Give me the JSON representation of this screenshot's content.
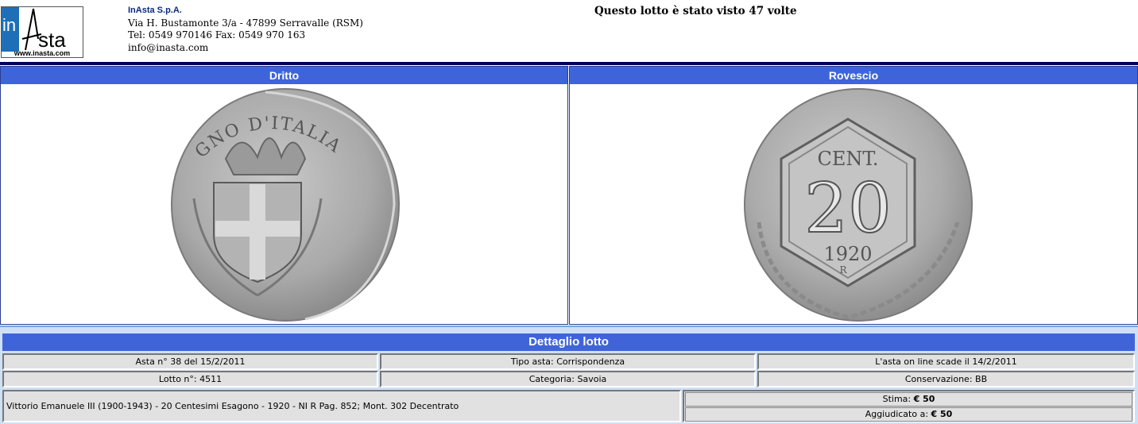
{
  "header": {
    "logo_url_text": "www.inasta.com",
    "company_name": "InAsta S.p.A.",
    "address": "Via H. Bustamonte 3/a - 47899 Serravalle (RSM)",
    "phones": "Tel: 0549 970146 Fax: 0549 970 163",
    "email": "info@inasta.com",
    "views_text": "Questo lotto è stato visto 47 volte"
  },
  "panels": {
    "obverse_title": "Dritto",
    "reverse_title": "Rovescio",
    "obverse_legend": "GNO D'ITALIA",
    "reverse_cent": "CENT.",
    "reverse_value": "20",
    "reverse_year": "1920",
    "reverse_mint": "R"
  },
  "detail": {
    "title": "Dettaglio lotto",
    "asta": "Asta n° 38 del 15/2/2011",
    "tipo_asta": "Tipo asta: Corrispondenza",
    "scadenza": "L'asta on line scade il 14/2/2011",
    "lotto": "Lotto n°: 4511",
    "categoria": "Categoria: Savoia",
    "conservazione": "Conservazione: BB",
    "description": "Vittorio Emanuele III (1900-1943) - 20 Centesimi Esagono - 1920 - NI R Pag. 852; Mont. 302 Decentrato",
    "stima_label": "Stima: ",
    "stima_value": "€ 50",
    "aggiudicato_label": "Aggiudicato a: ",
    "aggiudicato_value": "€ 50"
  },
  "colors": {
    "title_bar": "#3f64da",
    "top_rule": "#000058",
    "detail_bg": "#cfe0f5",
    "cell_bg": "#e1e1e1"
  }
}
